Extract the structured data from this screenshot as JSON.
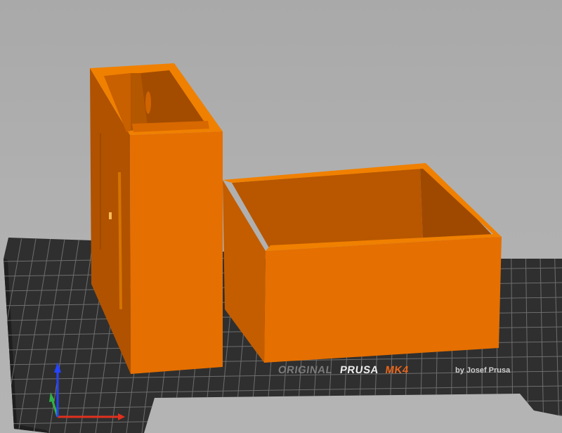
{
  "viewport": {
    "background_color": "#b0b0b0",
    "bed": {
      "brand_original": "ORIGINAL",
      "brand_prusa": "PRUSA",
      "brand_model": "MK4",
      "brand_byline": "by Josef Prusa",
      "surface_color": "#2f2f2f",
      "grid_color": "#6e6e6e",
      "accent_color": "#e8661c"
    },
    "objects": [
      {
        "name": "tall-holder",
        "color": "#e36d00"
      },
      {
        "name": "open-box",
        "color": "#e36d00"
      }
    ],
    "axes": {
      "x_color": "#e0301e",
      "y_color": "#2fb34a",
      "z_color": "#2444ff"
    }
  }
}
